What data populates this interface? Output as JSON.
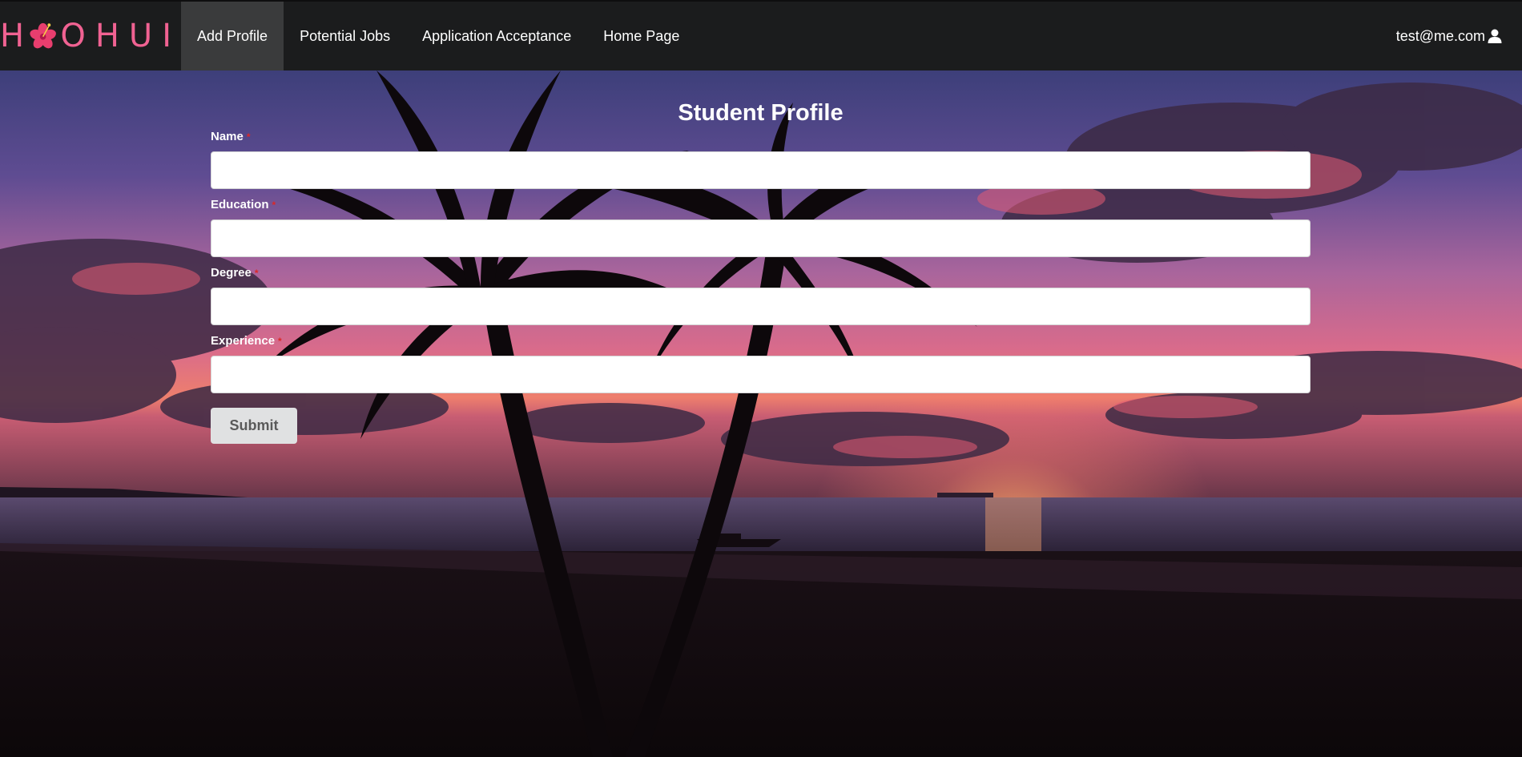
{
  "brand": {
    "logo_text_left": "H",
    "logo_text_right": "OHUI"
  },
  "nav": {
    "items": [
      {
        "label": "Add Profile",
        "active": true
      },
      {
        "label": "Potential Jobs",
        "active": false
      },
      {
        "label": "Application Acceptance",
        "active": false
      },
      {
        "label": "Home Page",
        "active": false
      }
    ],
    "user_email": "test@me.com"
  },
  "form": {
    "title": "Student Profile",
    "fields": [
      {
        "label": "Name",
        "required_mark": "*",
        "value": ""
      },
      {
        "label": "Education",
        "required_mark": "*",
        "value": ""
      },
      {
        "label": "Degree",
        "required_mark": "*",
        "value": ""
      },
      {
        "label": "Experience",
        "required_mark": "*",
        "value": ""
      }
    ],
    "submit_label": "Submit"
  },
  "colors": {
    "navbar": "#1b1c1d",
    "active_nav": "#3a3b3c",
    "logo": "#f06292",
    "required": "#db2828"
  },
  "icons": {
    "logo": "hibiscus-icon",
    "user": "user-icon"
  }
}
